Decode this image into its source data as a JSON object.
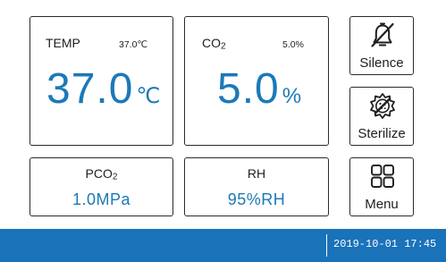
{
  "temp": {
    "label": "TEMP",
    "setpoint": "37.0℃",
    "value": "37.0",
    "unit": "℃"
  },
  "co2": {
    "label_main": "CO",
    "label_sub": "2",
    "setpoint": "5.0%",
    "value": "5.0",
    "unit": "%"
  },
  "pco2": {
    "label_main": "PCO",
    "label_sub": "2",
    "value": "1.0MPa"
  },
  "rh": {
    "label": "RH",
    "value": "95%RH"
  },
  "buttons": {
    "silence": "Silence",
    "sterilize": "Sterilize",
    "menu": "Menu"
  },
  "status": {
    "datetime": "2019-10-01  17:45"
  },
  "colors": {
    "accent": "#1c79b7",
    "statusbar": "#1a72b9",
    "border": "#2b2b2b"
  },
  "icons": {
    "silence": "bell-slash-icon",
    "sterilize": "sterilize-icon",
    "menu": "grid-icon"
  }
}
